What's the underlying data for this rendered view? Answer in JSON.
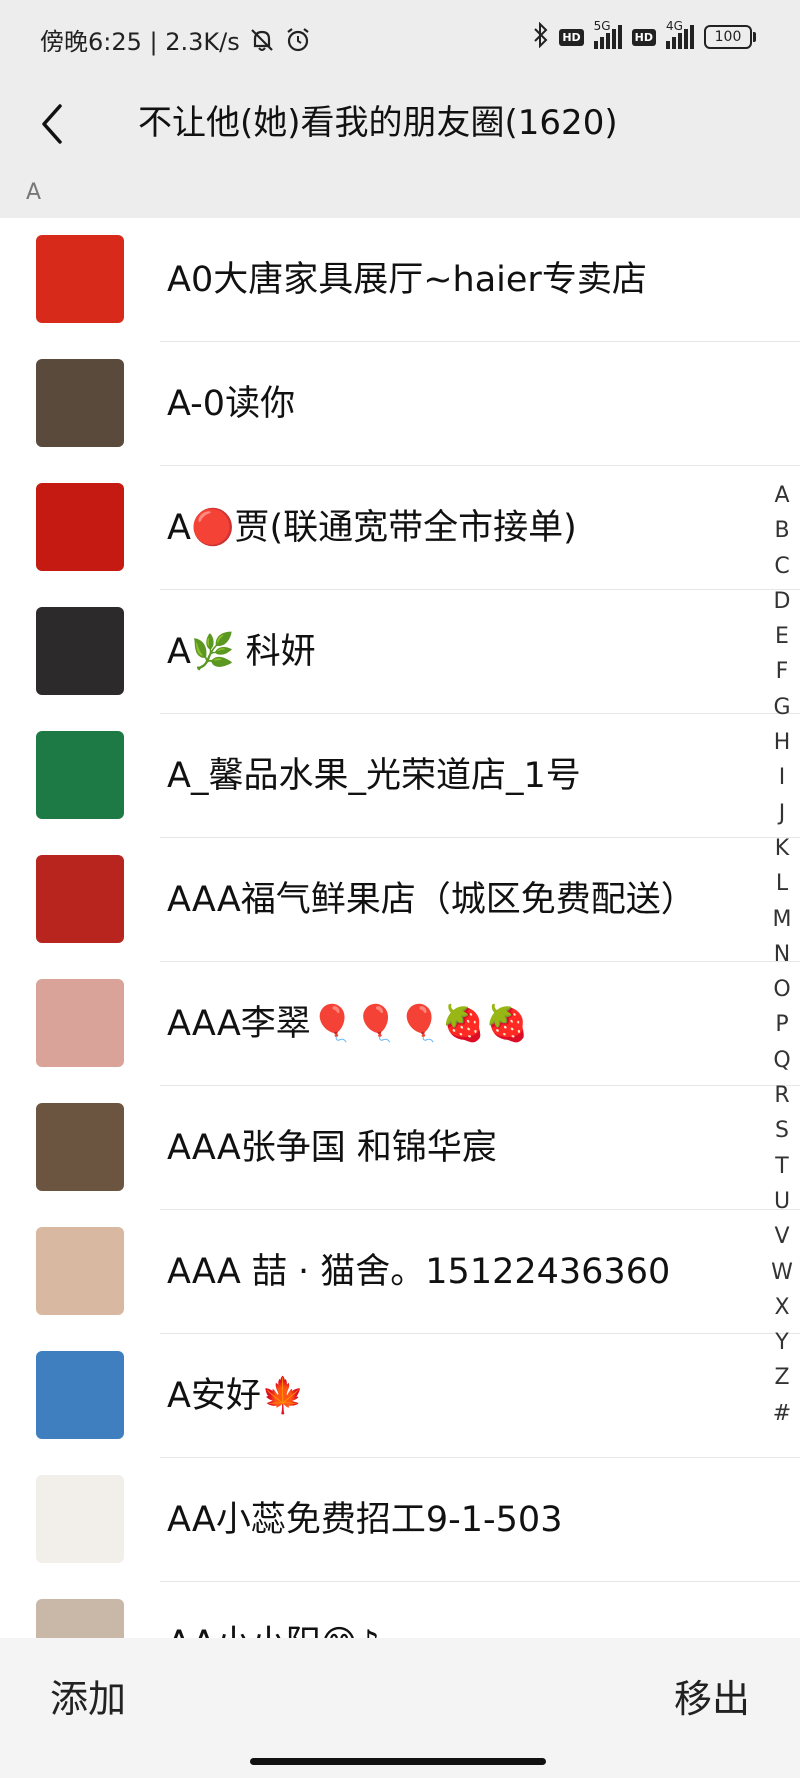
{
  "status_bar": {
    "left_text": "傍晚6:25 | 2.3K/s",
    "net_gen_1": "5G",
    "net_gen_2": "4G",
    "hd_1": "HD",
    "hd_2": "HD",
    "battery": "100"
  },
  "header": {
    "title": "不让他(她)看我的朋友圈(1620)"
  },
  "section": {
    "letter": "A"
  },
  "contacts": [
    {
      "name": "A0大唐家具展厅~haier专卖店",
      "avatar_icon": "furniture-store-ad-avatar",
      "avatar_color": "#d82a1a"
    },
    {
      "name": "A-0读你",
      "avatar_icon": "man-sunglasses-photo-avatar",
      "avatar_color": "#5a4a3c"
    },
    {
      "name": "A🔴贾(联通宽带全市接单)",
      "avatar_icon": "red-calligraphy-avatar",
      "avatar_color": "#c41a12"
    },
    {
      "name": "A🌿 科妍",
      "avatar_icon": "woman-portrait-avatar",
      "avatar_color": "#2c2a2a"
    },
    {
      "name": "A_馨品水果_光荣道店_1号",
      "avatar_icon": "green-fruit-shop-logo-avatar",
      "avatar_color": "#1e7a45"
    },
    {
      "name": "AAA福气鲜果店（城区免费配送）",
      "avatar_icon": "cartoon-girl-red-avatar",
      "avatar_color": "#b8241e"
    },
    {
      "name": "AAA李翠🎈🎈🎈🍓🍓",
      "avatar_icon": "woman-selfie-avatar",
      "avatar_color": "#d9a39a"
    },
    {
      "name": "AAA张争国 和锦华宸",
      "avatar_icon": "man-suit-photo-avatar",
      "avatar_color": "#6b5540"
    },
    {
      "name": "AAA 喆 · 猫舍。15122436360",
      "avatar_icon": "cat-photo-avatar",
      "avatar_color": "#d8b8a0"
    },
    {
      "name": "A安好🍁",
      "avatar_icon": "sea-landscape-avatar",
      "avatar_color": "#3f7fc0"
    },
    {
      "name": "AA小蕊免费招工9-1-503",
      "avatar_icon": "calligraphy-heart-avatar",
      "avatar_color": "#f2eeea"
    },
    {
      "name": "AA小小阳😊♪",
      "avatar_icon": "portrait-photo-avatar",
      "avatar_color": "#c9b8a8"
    }
  ],
  "index_letters": [
    "A",
    "B",
    "C",
    "D",
    "E",
    "F",
    "G",
    "H",
    "I",
    "J",
    "K",
    "L",
    "M",
    "N",
    "O",
    "P",
    "Q",
    "R",
    "S",
    "T",
    "U",
    "V",
    "W",
    "X",
    "Y",
    "Z",
    "#"
  ],
  "bottom": {
    "add_label": "添加",
    "remove_label": "移出"
  }
}
